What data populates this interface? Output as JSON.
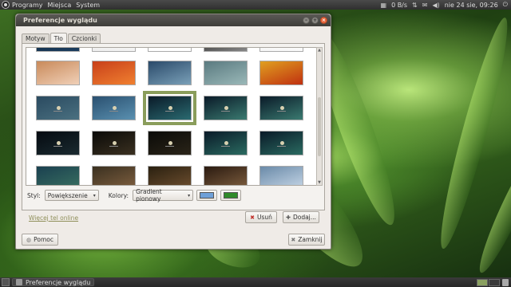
{
  "top_panel": {
    "menus": [
      "Programy",
      "Miejsca",
      "System"
    ],
    "network_speed": "0 B/s",
    "clock": "nie 24 sie, 09:26"
  },
  "window": {
    "title": "Preferencje wyglądu",
    "tabs": [
      {
        "label": "Motyw",
        "active": false
      },
      {
        "label": "Tło",
        "active": true
      },
      {
        "label": "Czcionki",
        "active": false
      }
    ],
    "style_label": "Styl:",
    "style_value": "Powiększenie",
    "colors_label": "Kolory:",
    "colors_value": "Gradient pionowy",
    "color1": "#6fa0d8",
    "color2": "#2f8a2a",
    "more_online_link": "Więcej tel online",
    "remove_button": "Usuń",
    "add_button": "Dodaj...",
    "help_button": "Pomoc",
    "close_button": "Zamknij"
  },
  "wallpapers": [
    {
      "colors": [
        "#0f2a44",
        "#1b3d5e"
      ],
      "selected": false
    },
    {
      "colors": [
        "#e8e8e8",
        "#f4f4f4"
      ],
      "selected": false
    },
    {
      "colors": [
        "#ffffff",
        "#ffffff"
      ],
      "selected": false
    },
    {
      "colors": [
        "#1a1a1a",
        "#888888"
      ],
      "selected": false
    },
    {
      "colors": [
        "#f2f2f2",
        "#fafafa"
      ],
      "selected": false
    },
    {
      "colors": [
        "#c98a5a",
        "#f0d0b8"
      ],
      "selected": false
    },
    {
      "colors": [
        "#c8401a",
        "#f08030"
      ],
      "selected": false
    },
    {
      "colors": [
        "#2a4a6a",
        "#7aa0b8"
      ],
      "selected": false
    },
    {
      "colors": [
        "#5a7a80",
        "#9ab8b8"
      ],
      "selected": false
    },
    {
      "colors": [
        "#e0a020",
        "#c03010"
      ],
      "selected": false
    },
    {
      "colors": [
        "#2a4a60",
        "#4a7080"
      ],
      "selected": false
    },
    {
      "colors": [
        "#2a5070",
        "#5a90b0"
      ],
      "selected": false
    },
    {
      "colors": [
        "#0a1a28",
        "#2a6a70"
      ],
      "selected": true
    },
    {
      "colors": [
        "#0a1a28",
        "#3a7a70"
      ],
      "selected": false
    },
    {
      "colors": [
        "#0a1a28",
        "#3a7a70"
      ],
      "selected": false
    },
    {
      "colors": [
        "#050a10",
        "#1a2a30"
      ],
      "selected": false
    },
    {
      "colors": [
        "#0a0a08",
        "#3a3020"
      ],
      "selected": false
    },
    {
      "colors": [
        "#0a0a08",
        "#2a2418"
      ],
      "selected": false
    },
    {
      "colors": [
        "#0a1a28",
        "#2a6a60"
      ],
      "selected": false
    },
    {
      "colors": [
        "#0a1a28",
        "#2a6a60"
      ],
      "selected": false
    },
    {
      "colors": [
        "#1a4050",
        "#3a7060"
      ],
      "selected": false
    },
    {
      "colors": [
        "#3a3020",
        "#806040"
      ],
      "selected": false
    },
    {
      "colors": [
        "#2a2010",
        "#705030"
      ],
      "selected": false
    },
    {
      "colors": [
        "#2a1a10",
        "#806040"
      ],
      "selected": false
    },
    {
      "colors": [
        "#6a8aa8",
        "#c8d8e8"
      ],
      "selected": false
    }
  ],
  "taskbar": {
    "task_label": "Preferencje wyglądu"
  }
}
